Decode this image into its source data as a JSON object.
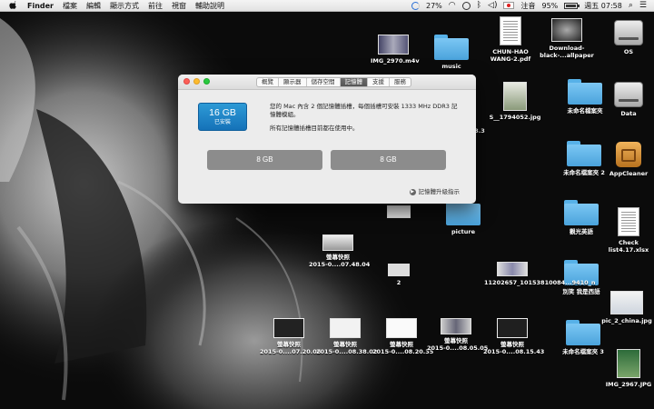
{
  "menubar": {
    "app": "Finder",
    "items": [
      "檔案",
      "編輯",
      "顯示方式",
      "前往",
      "視窗",
      "輔助說明"
    ],
    "status": {
      "time_machine": "27%",
      "input_method": "注音",
      "battery": "95%",
      "battery_level": 0.95,
      "clock": "週五 07:58"
    }
  },
  "window": {
    "tabs": [
      "概覽",
      "顯示器",
      "儲存空間",
      "記憶體",
      "支援",
      "服務"
    ],
    "active_tab": "記憶體",
    "memory_size": "16 GB",
    "memory_state": "已安裝",
    "description": "您的 Mac 內含 2 個記憶體插槽，每個插槽可安裝 1333 MHz DDR3 記憶體模組。",
    "note": "所有記憶體插槽目前都在使用中。",
    "slots": [
      "8 GB",
      "8 GB"
    ],
    "upgrade_link": "記憶體升級指示"
  },
  "desktop": {
    "col_right": [
      "OS",
      "Data",
      "AppCleaner",
      "Check list4.17.xlsx",
      "pic_2_china.jpg",
      "IMG_2967.JPG"
    ],
    "col_mid": [
      "Download-black-...allpaper",
      "未命名檔案夾",
      "未命名檔案夾 2",
      "觀光英語",
      "別笑 我是西語",
      "未命名檔案夾 3"
    ],
    "col_left": [
      "CHUN-HAO WANG-2.pdf",
      "S__1794052.jpg",
      "11202657_10153810084...9410_n"
    ],
    "top_row": [
      "IMG_2970.m4v",
      "music"
    ],
    "mid_items": [
      "picture",
      "2",
      "3.3"
    ],
    "screenshot_a": [
      "螢幕快照",
      "2015-0....07.48.04"
    ],
    "screenshots_bottom": [
      [
        "螢幕快照",
        "2015-0....07.20.06"
      ],
      [
        "螢幕快照",
        "2015-0....08.38.02"
      ],
      [
        "螢幕快照",
        "2015-0....08.20.35"
      ],
      [
        "螢幕快照",
        "2015-0....08.05.05"
      ],
      [
        "螢幕快照",
        "2015-0....08.15.43"
      ]
    ]
  },
  "colors": {
    "accent": "#1a82c8",
    "slot": "#8c8c8c",
    "folder": "#5ab4ea"
  }
}
